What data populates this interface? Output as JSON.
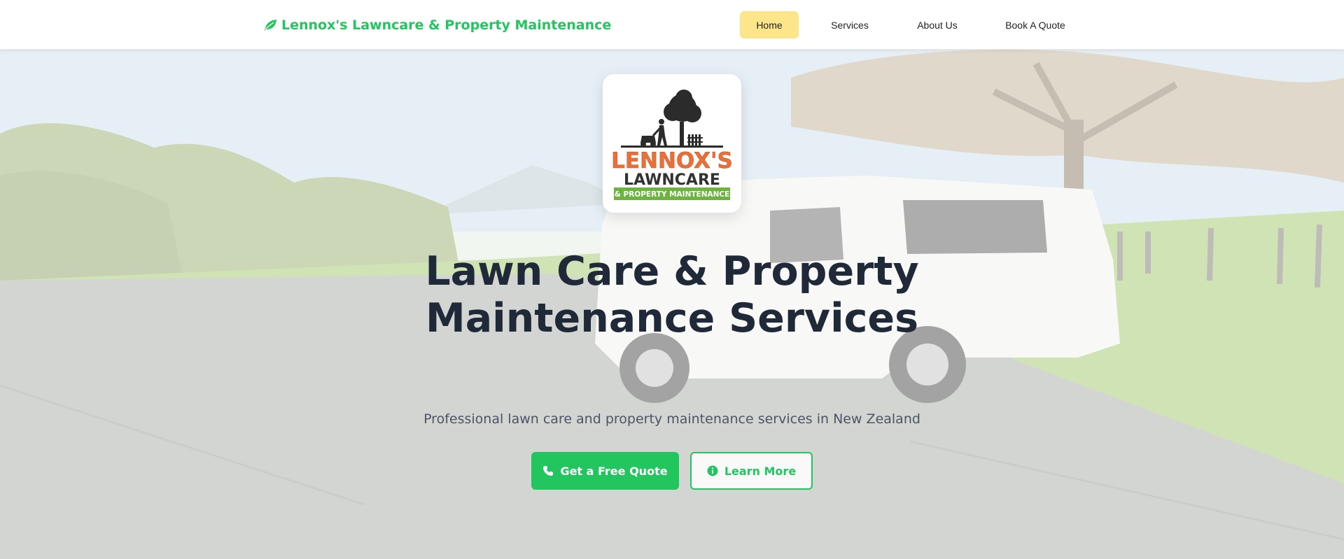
{
  "navbar": {
    "brand": "Lennox's Lawncare & Property Maintenance",
    "brand_icon": "leaf-icon",
    "links": [
      {
        "label": "Home",
        "active": true
      },
      {
        "label": "Services",
        "active": false
      },
      {
        "label": "About Us",
        "active": false
      },
      {
        "label": "Book A Quote",
        "active": false
      }
    ]
  },
  "hero": {
    "logo": {
      "line1": "LENNOX'S",
      "line2": "LAWNCARE",
      "line3": "& PROPERTY MAINTENANCE"
    },
    "title": "Lawn Care & Property Maintenance Services",
    "subtitle": "Professional lawn care and property maintenance services in New Zealand",
    "primary_button": {
      "label": "Get a Free Quote",
      "icon": "phone-icon"
    },
    "secondary_button": {
      "label": "Learn More",
      "icon": "info-circle-icon"
    }
  },
  "colors": {
    "brand_green": "#22c55e",
    "active_nav_bg": "#fde68a",
    "heading_text": "#1f2937",
    "logo_orange": "#e8703a",
    "logo_dark": "#333333"
  }
}
